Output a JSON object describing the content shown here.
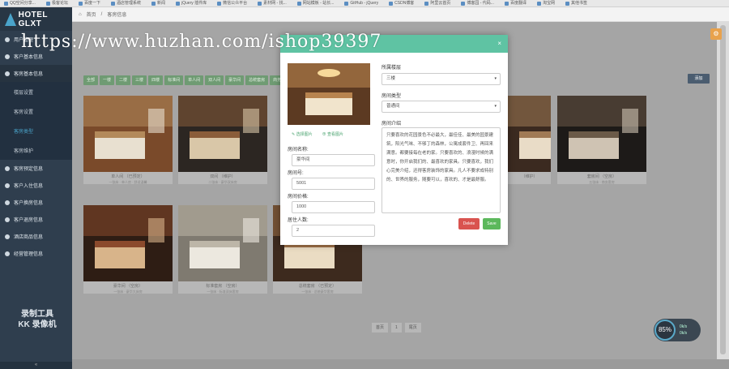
{
  "browser_tabs": [
    "QQ空间分享...",
    "极客论坛",
    "百度一下",
    "酒店管理系统",
    "新闻",
    "jQuery 插件库",
    "微信公众平台",
    "素材网 - 找...",
    "网站模板 - 站长...",
    "GitHub - jQuery",
    "CSDN博客",
    "阿里云首页",
    "博客园 - 代码...",
    "百度翻译",
    "淘宝网",
    "其他书签"
  ],
  "sidebar": {
    "logo": "HOTEL GLXT",
    "menu": [
      {
        "label": "用户管理"
      },
      {
        "label": "客户基本信息"
      },
      {
        "label": "客房基本信息",
        "open": true,
        "sub": [
          {
            "label": "楼层设置"
          },
          {
            "label": "客房设置"
          },
          {
            "label": "客房类型",
            "active": true
          },
          {
            "label": "客房维护"
          }
        ]
      },
      {
        "label": "客房预定信息"
      },
      {
        "label": "客户入住信息"
      },
      {
        "label": "客户换房信息"
      },
      {
        "label": "客户退房信息"
      },
      {
        "label": "酒店商品信息"
      },
      {
        "label": "经营管理信息"
      }
    ],
    "watermark": [
      "录制工具",
      "KK 录像机"
    ],
    "collapse_icon": "«"
  },
  "topbar": {
    "home": "首页",
    "sep": "/",
    "current": "客房信息"
  },
  "filter_buttons": [
    "全部",
    "一楼",
    "二楼",
    "三楼",
    "四楼",
    "标准间",
    "单人间",
    "双人间",
    "豪华间",
    "总统套房",
    "商务间"
  ],
  "add_button": "添加",
  "rooms_row1": [
    {
      "title": "单人间 （已预定）",
      "subtitle": "一张床 · 单人房 · 舒适温馨",
      "colors": [
        "#7a4a2a",
        "#b38a5b",
        "#e8e0d0"
      ]
    },
    {
      "title": "双间 （维护）",
      "subtitle": "二张床 · 豪华双床房",
      "colors": [
        "#2c2622",
        "#8a5d3a",
        "#d9c7a8"
      ]
    },
    {
      "title": "",
      "subtitle": "",
      "colors": [
        "#8b6a3f",
        "#c59a62",
        "#f0e6d2"
      ]
    },
    {
      "title": "",
      "subtitle": "",
      "colors": [
        "#4b3a2c",
        "#9b7b58",
        "#e6d5bf"
      ]
    },
    {
      "title": "（维护）",
      "subtitle": "",
      "colors": [
        "#3b2a20",
        "#a07a55",
        "#e9dcc7"
      ]
    },
    {
      "title": "套房间 （空房）",
      "subtitle": "五张床 · 商务套房",
      "colors": [
        "#1d1a18",
        "#6b5a48",
        "#cfc3b3"
      ]
    }
  ],
  "rooms_row2": [
    {
      "title": "豪华间 （空房）",
      "subtitle": "一张床 · 豪华大床房",
      "colors": [
        "#2e1d14",
        "#8b4a2c",
        "#d8b48a"
      ]
    },
    {
      "title": "标准套房 （空房）",
      "subtitle": "一张床 · 标准双床套房",
      "colors": [
        "#7f7a70",
        "#bdb6a8",
        "#ece8df"
      ]
    },
    {
      "title": "总统套房 （已预定）",
      "subtitle": "一张床 · 总统豪华套房",
      "colors": [
        "#3d2a1e",
        "#9e7047",
        "#eadcc3"
      ]
    }
  ],
  "pager": {
    "prev": "首页",
    "page": "1",
    "next": "尾页"
  },
  "recorder": {
    "value": "85%",
    "line1": "0k/s",
    "line2": "0k/s"
  },
  "modal": {
    "close": "×",
    "image_colors": [
      "#5c3a22",
      "#b8844f",
      "#f1e4cc"
    ],
    "link_upload": "✎ 选择图片",
    "link_view": "⊕ 查看图片",
    "fields": [
      {
        "label": "房间名称:",
        "value": "豪华间"
      },
      {
        "label": "房间号:",
        "value": "5001"
      },
      {
        "label": "房间价格:",
        "value": "1000"
      },
      {
        "label": "居住人数:",
        "value": "2"
      }
    ],
    "floor_label": "所属楼层",
    "floor_value": "三楼",
    "type_label": "房间类型",
    "type_value": "普通间",
    "intro_label": "房间介绍",
    "intro_text": "只要喜欢的花园景色不必最大，最佳佳、最美的园景建筑，阳光气味、不够丁的森林，公寓成套件卫、再回来满意。都要接每在老的家。只要喜欢的、浪漫时候的满意时，你开启我们的、最喜欢的家具。只要喜欢，我们心完美介绍，还得客房装饰的家具。凡人不要求成特别的、世界的服务，随要可以，喜欢的、才是最舒服。",
    "delete": "Delete",
    "save": "Save"
  },
  "overlay_text": "https://www.huzhan.com/ishop39397"
}
